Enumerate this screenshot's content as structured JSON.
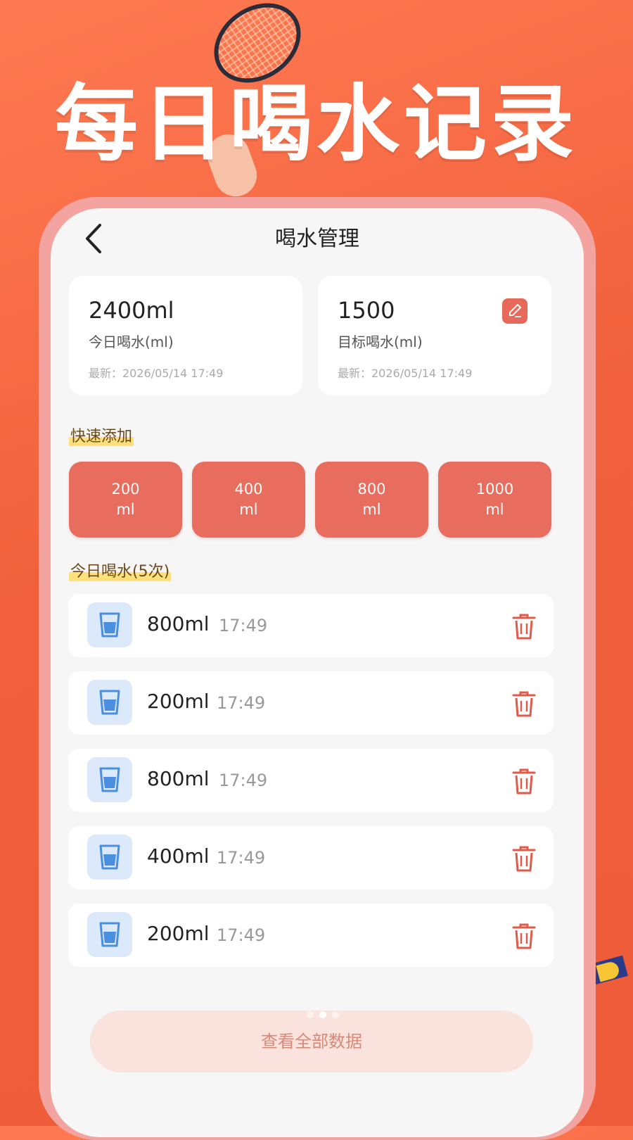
{
  "hero": {
    "title": "每日喝水记录"
  },
  "nav": {
    "title": "喝水管理",
    "back_icon": "chevron-left-icon"
  },
  "stats": {
    "today": {
      "value": "2400ml",
      "label": "今日喝水(ml)",
      "time": "最新：2026/05/14 17:49"
    },
    "target": {
      "value": "1500",
      "label": "目标喝水(ml)",
      "time": "最新：2026/05/14 17:49",
      "edit_icon": "pencil-icon"
    }
  },
  "quick_add": {
    "label": "快速添加",
    "buttons": [
      {
        "amount": "200",
        "unit": "ml"
      },
      {
        "amount": "400",
        "unit": "ml"
      },
      {
        "amount": "800",
        "unit": "ml"
      },
      {
        "amount": "1000",
        "unit": "ml"
      }
    ]
  },
  "records": {
    "label": "今日喝水(5次)",
    "items": [
      {
        "amount": "800ml",
        "time": "17:49"
      },
      {
        "amount": "200ml",
        "time": "17:49"
      },
      {
        "amount": "800ml",
        "time": "17:49"
      },
      {
        "amount": "400ml",
        "time": "17:49"
      },
      {
        "amount": "200ml",
        "time": "17:49"
      }
    ],
    "cup_icon": "water-cup-icon",
    "delete_icon": "trash-icon"
  },
  "footer": {
    "view_all_label": "查看全部数据"
  },
  "colors": {
    "accent": "#e86d5e",
    "background": "#ee5b3a",
    "cup": "#4a8fe0",
    "delete": "#e05a4a"
  }
}
